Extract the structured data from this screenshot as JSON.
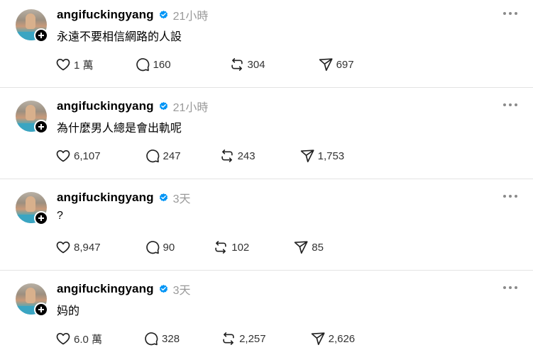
{
  "posts": [
    {
      "username": "angifuckingyang",
      "time": "21小時",
      "text": "永遠不要相信網路的人設",
      "likes": "1 萬",
      "replies": "160",
      "reposts": "304",
      "shares": "697"
    },
    {
      "username": "angifuckingyang",
      "time": "21小時",
      "text": "為什麼男人總是會出軌呢",
      "likes": "6,107",
      "replies": "247",
      "reposts": "243",
      "shares": "1,753"
    },
    {
      "username": "angifuckingyang",
      "time": "3天",
      "text": "?",
      "likes": "8,947",
      "replies": "90",
      "reposts": "102",
      "shares": "85"
    },
    {
      "username": "angifuckingyang",
      "time": "3天",
      "text": "妈的",
      "likes": "6.0 萬",
      "replies": "328",
      "reposts": "2,257",
      "shares": "2,626"
    }
  ],
  "icons": {
    "verified": "verified-badge-icon",
    "more": "more-options-icon",
    "like": "heart-icon",
    "reply": "comment-bubble-icon",
    "repost": "repost-icon",
    "share": "send-icon",
    "follow": "plus-icon"
  },
  "colors": {
    "verified": "#0095f6",
    "muted": "#999999",
    "text": "#000000"
  }
}
